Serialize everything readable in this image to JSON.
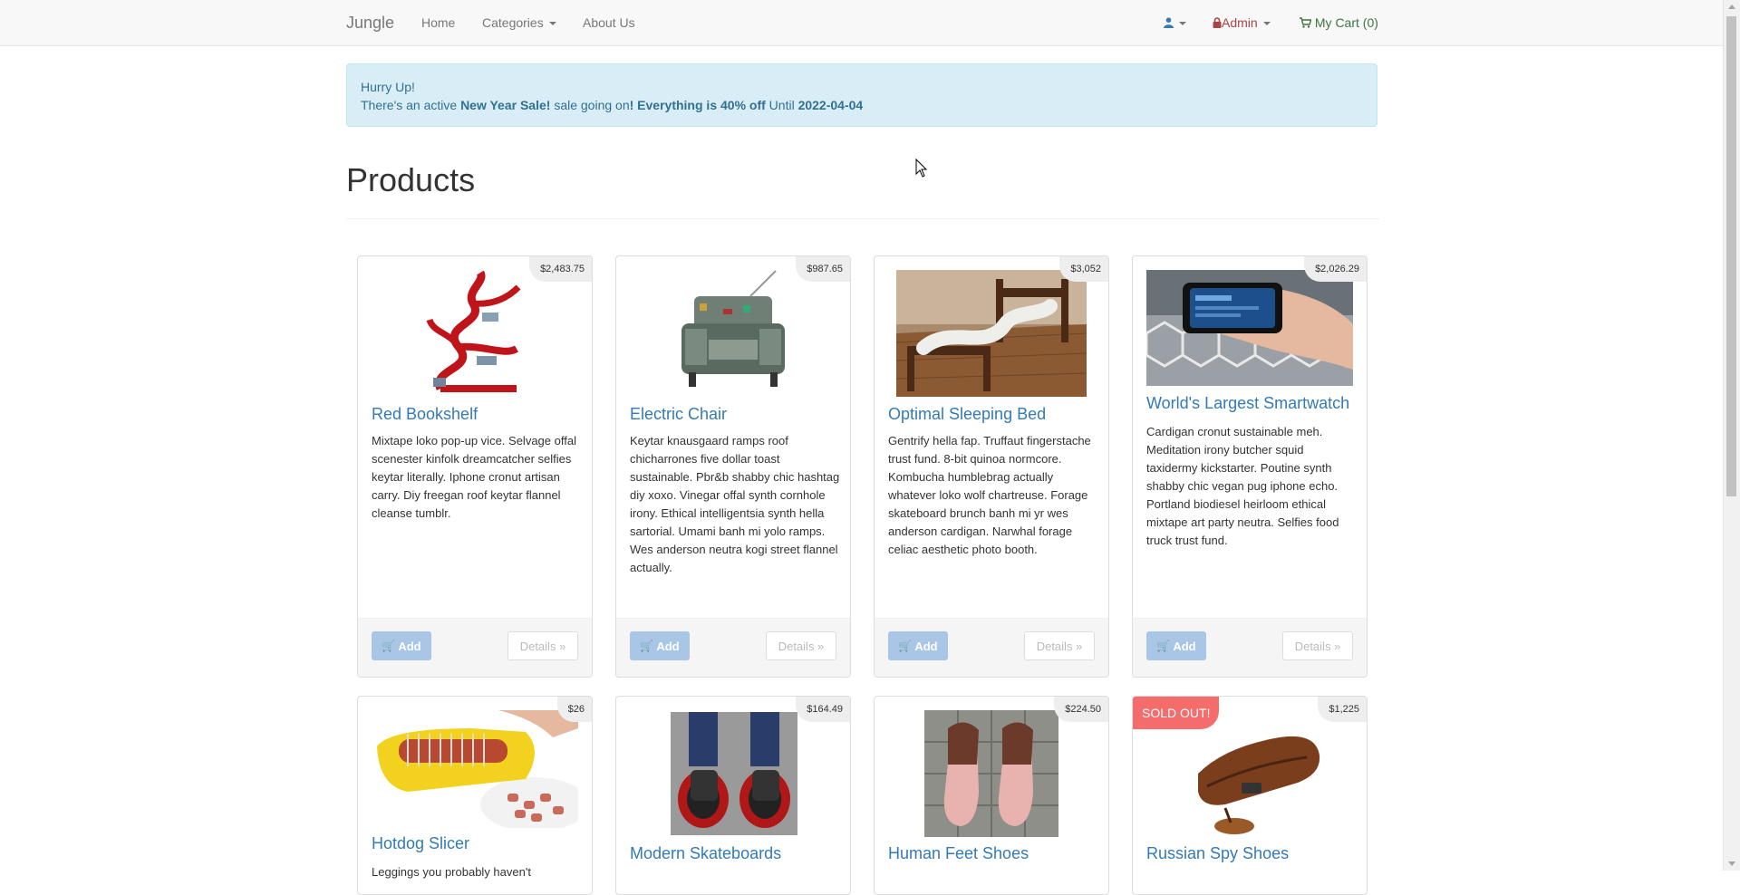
{
  "navbar": {
    "brand": "Jungle",
    "home": "Home",
    "categories": "Categories",
    "about": "About Us",
    "user_icon": "user-icon",
    "admin": "Admin",
    "cart": "My Cart (0)"
  },
  "alert": {
    "line1": "Hurry Up!",
    "prefix": "There's an active ",
    "sale_name": "New Year Sale!",
    "middle": " sale going on",
    "bang": "!",
    "offer": " Everything is 40% off",
    "until": " Until ",
    "date": "2022-04-04"
  },
  "page": {
    "title": "Products"
  },
  "products": [
    {
      "name": "Red Bookshelf",
      "price": "$2,483.75",
      "desc": "Mixtape loko pop-up vice. Selvage offal scenester kinfolk dreamcatcher selfies keytar literally. Iphone cronut artisan carry. Diy freegan roof keytar flannel cleanse tumblr.",
      "add": "Add",
      "details": "Details »"
    },
    {
      "name": "Electric Chair",
      "price": "$987.65",
      "desc": "Keytar knausgaard ramps roof chicharrones five dollar toast sustainable. Pbr&b shabby chic hashtag diy xoxo. Vinegar offal synth cornhole irony. Ethical intelligentsia synth hella sartorial. Umami banh mi yolo ramps. Wes anderson neutra kogi street flannel actually.",
      "add": "Add",
      "details": "Details »"
    },
    {
      "name": "Optimal Sleeping Bed",
      "price": "$3,052",
      "desc": "Gentrify hella fap. Truffaut fingerstache trust fund. 8-bit quinoa normcore. Kombucha humblebrag actually whatever loko wolf chartreuse. Forage skateboard brunch banh mi yr wes anderson cardigan. Narwhal forage celiac aesthetic photo booth.",
      "add": "Add",
      "details": "Details »"
    },
    {
      "name": "World's Largest Smartwatch",
      "price": "$2,026.29",
      "desc": "Cardigan cronut sustainable meh. Meditation irony butcher squid taxidermy kickstarter. Poutine synth shabby chic vegan pug iphone echo. Portland biodiesel heirloom ethical mixtape art party neutra. Selfies food truck trust fund.",
      "add": "Add",
      "details": "Details »"
    },
    {
      "name": "Hotdog Slicer",
      "price": "$26",
      "desc": "Leggings you probably haven't"
    },
    {
      "name": "Modern Skateboards",
      "price": "$164.49"
    },
    {
      "name": "Human Feet Shoes",
      "price": "$224.50"
    },
    {
      "name": "Russian Spy Shoes",
      "price": "$1,225",
      "badge": "SOLD OUT!"
    }
  ],
  "colors": {
    "link": "#337ab7",
    "alert_bg": "#d9edf7",
    "sold_out": "#f56c6c",
    "add_button": "#a9c6e6"
  }
}
